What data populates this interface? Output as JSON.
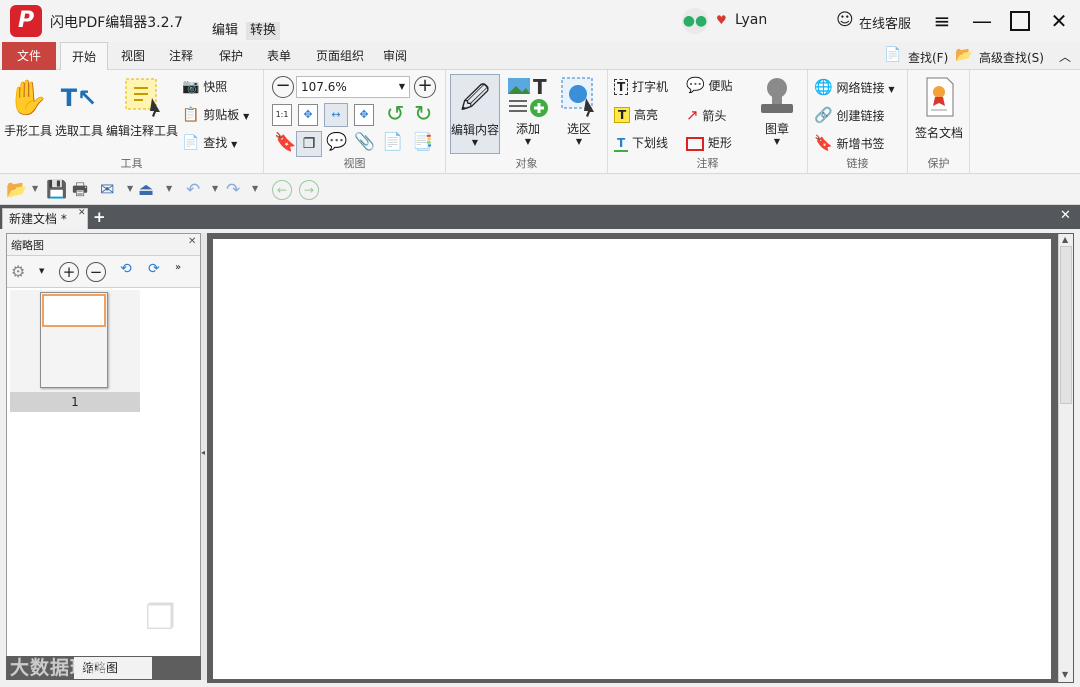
{
  "app": {
    "title": "闪电PDF编辑器3.2.7",
    "logo_letter": "P",
    "title_tabs": [
      "编辑",
      "转换"
    ],
    "user": "Lyan",
    "online_service": "在线客服"
  },
  "ribbon_tabs": [
    "文件",
    "开始",
    "视图",
    "注释",
    "保护",
    "表单",
    "页面组织",
    "审阅"
  ],
  "find": {
    "label": "查找(F)",
    "advanced": "高级查找(S)"
  },
  "groups": {
    "tools": {
      "label": "工具",
      "hand": "手形工具",
      "select": "选取工具",
      "edit_annot": "编辑注释工具",
      "snapshot": "快照",
      "clipboard": "剪贴板",
      "search": "查找"
    },
    "view": {
      "label": "视图",
      "zoom": "107.6%"
    },
    "objects": {
      "label": "对象",
      "edit_content": "编辑内容",
      "add": "添加",
      "select_area": "选区"
    },
    "annotations": {
      "label": "注释",
      "typewriter": "打字机",
      "note": "便贴",
      "highlight": "高亮",
      "arrow": "箭头",
      "underline": "下划线",
      "rect": "矩形",
      "stamp": "图章"
    },
    "links": {
      "label": "链接",
      "web_link": "网络链接",
      "create_link": "创建链接",
      "add_bookmark": "新增书签"
    },
    "protect": {
      "label": "保护",
      "sign": "签名文档"
    }
  },
  "document_tab": "新建文档 *",
  "thumbnail_panel": {
    "title": "缩略图",
    "page_number": "1",
    "bottom_tab": "缩略图"
  },
  "watermark": "大数据环境",
  "colors": {
    "file_tab": "#c9443f",
    "logo": "#d8232a",
    "doc_background": "#5e5e5e"
  },
  "icons": [
    "wechat-icon",
    "vip-heart-icon",
    "smiley-icon",
    "menu-icon",
    "minimize-icon",
    "maximize-icon",
    "close-icon"
  ]
}
